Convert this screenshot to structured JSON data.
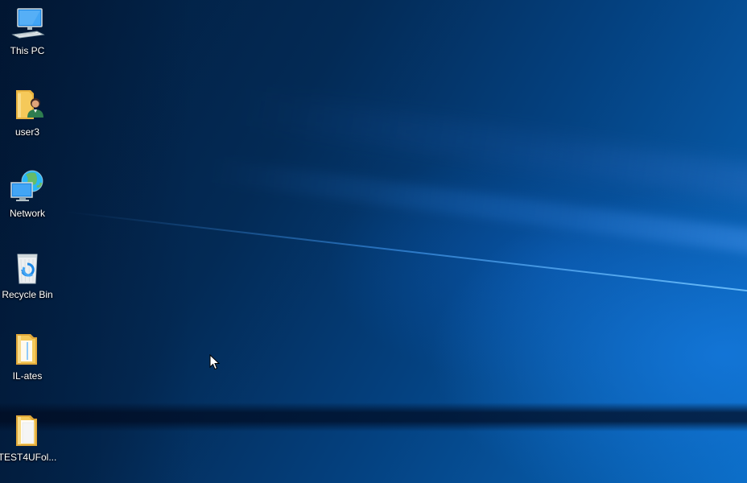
{
  "desktop": {
    "icons": [
      {
        "label": "This PC",
        "icon": "computer-icon"
      },
      {
        "label": "user3",
        "icon": "user-folder-icon"
      },
      {
        "label": "Network",
        "icon": "network-icon"
      },
      {
        "label": "Recycle Bin",
        "icon": "recycle-bin-icon"
      },
      {
        "label": "IL-ates",
        "icon": "folder-icon"
      },
      {
        "label": "TEST4UFol...",
        "icon": "folder-icon"
      }
    ]
  },
  "colors": {
    "wallpaper_dark": "#021c3c",
    "wallpaper_light": "#0a6cc4",
    "folder_yellow": "#f5c95a",
    "label_text": "#ffffff"
  }
}
